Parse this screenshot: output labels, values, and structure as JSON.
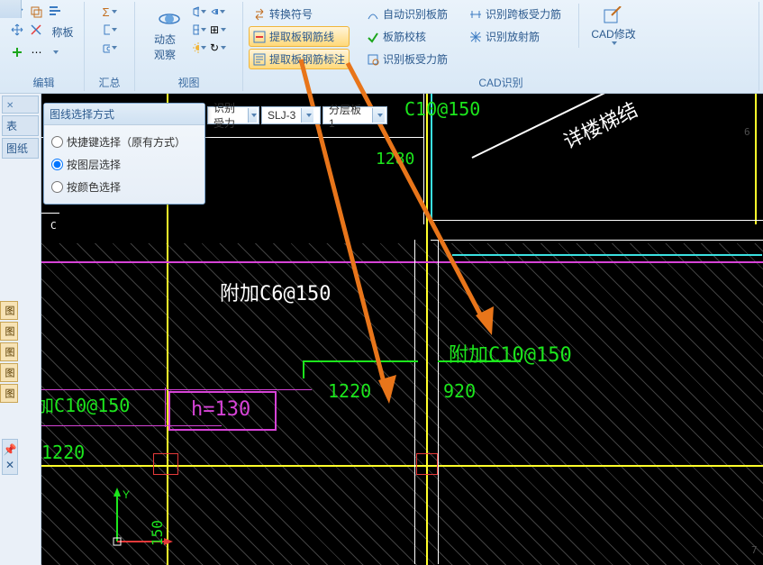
{
  "popup": {
    "title": "图线选择方式",
    "opt1": "快捷键选择（原有方式）",
    "opt2": "按图层选择",
    "opt3": "按颜色选择",
    "selected": "opt2"
  },
  "ribbon": {
    "group_edit": "编辑",
    "group_sum": "汇总",
    "group_view": "视图",
    "group_cad": "CAD识别",
    "cad_modify": "CAD修改",
    "dynobs": "动态观察",
    "calc_label": "称板",
    "convert_symbol": "转换符号",
    "extract_rebar_line": "提取板钢筋线",
    "extract_rebar_note": "提取板钢筋标注",
    "auto_rebar": "自动识别板筋",
    "check_rebar": "板筋校核",
    "rec_force": "识别板受力筋",
    "rec_span_force": "识别跨板受力筋",
    "rec_radiate": "识别放射筋"
  },
  "toolbar": {
    "rec_force_short": "识别受力",
    "combo1": "SLJ-3",
    "combo2": "分层板1"
  },
  "dock": {
    "tab1": "表",
    "tab2": "图纸"
  },
  "canvas": {
    "t1": "C10@150",
    "t2": "详楼梯结",
    "d_1280": "1280",
    "t3": "附加C6@150",
    "d_1220a": "1220",
    "d_920": "920",
    "t4": "附加C10@150",
    "t5": "加C10@150",
    "d_1220b": "1220",
    "h_130": "h=130",
    "d_150": "150",
    "num6": "6",
    "num7": "7"
  }
}
